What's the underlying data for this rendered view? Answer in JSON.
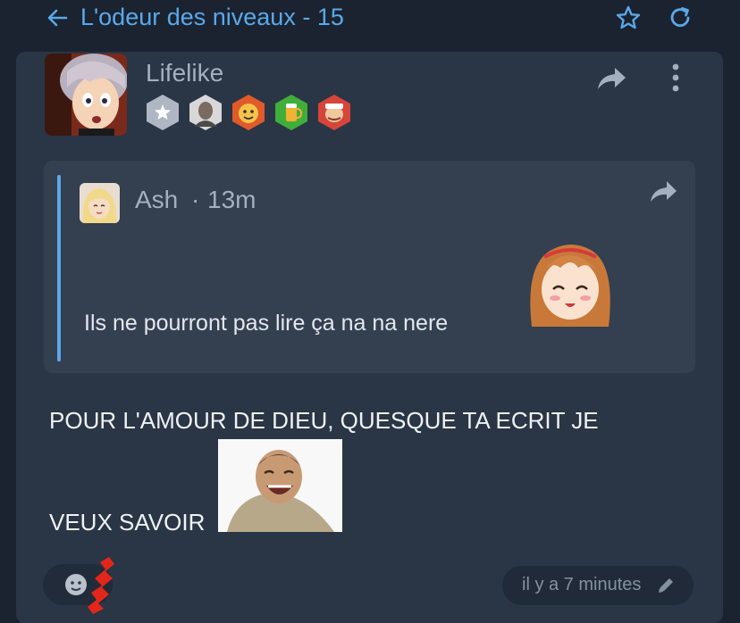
{
  "header": {
    "title": "L'odeur des niveaux - 15",
    "icons": [
      "arrow-left-icon",
      "star-outline-icon",
      "refresh-icon"
    ]
  },
  "post": {
    "author": "Lifelike",
    "icons": [
      "share-icon",
      "more-vertical-icon"
    ],
    "badges": [
      "star-badge",
      "portrait-badge",
      "face-badge",
      "beer-badge",
      "character-badge"
    ],
    "quote": {
      "author": "Ash",
      "separator": "·",
      "time": "13m",
      "text": "Ils ne pourront pas lire ça na na nere",
      "icons": [
        "share-icon"
      ]
    },
    "message_line1": "POUR L'AMOUR DE DIEU, QUESQUE TA ECRIT JE",
    "message_line2": "VEUX SAVOIR",
    "footer": {
      "timestamp": "il y a 7 minutes",
      "icons": [
        "emoji-reaction-icon",
        "pencil-icon"
      ]
    }
  },
  "colors": {
    "background": "#1b2330",
    "card": "#2a3545",
    "quote_bg": "#343f50",
    "accent": "#5aa9ea",
    "muted_text": "#a4b0bf"
  }
}
